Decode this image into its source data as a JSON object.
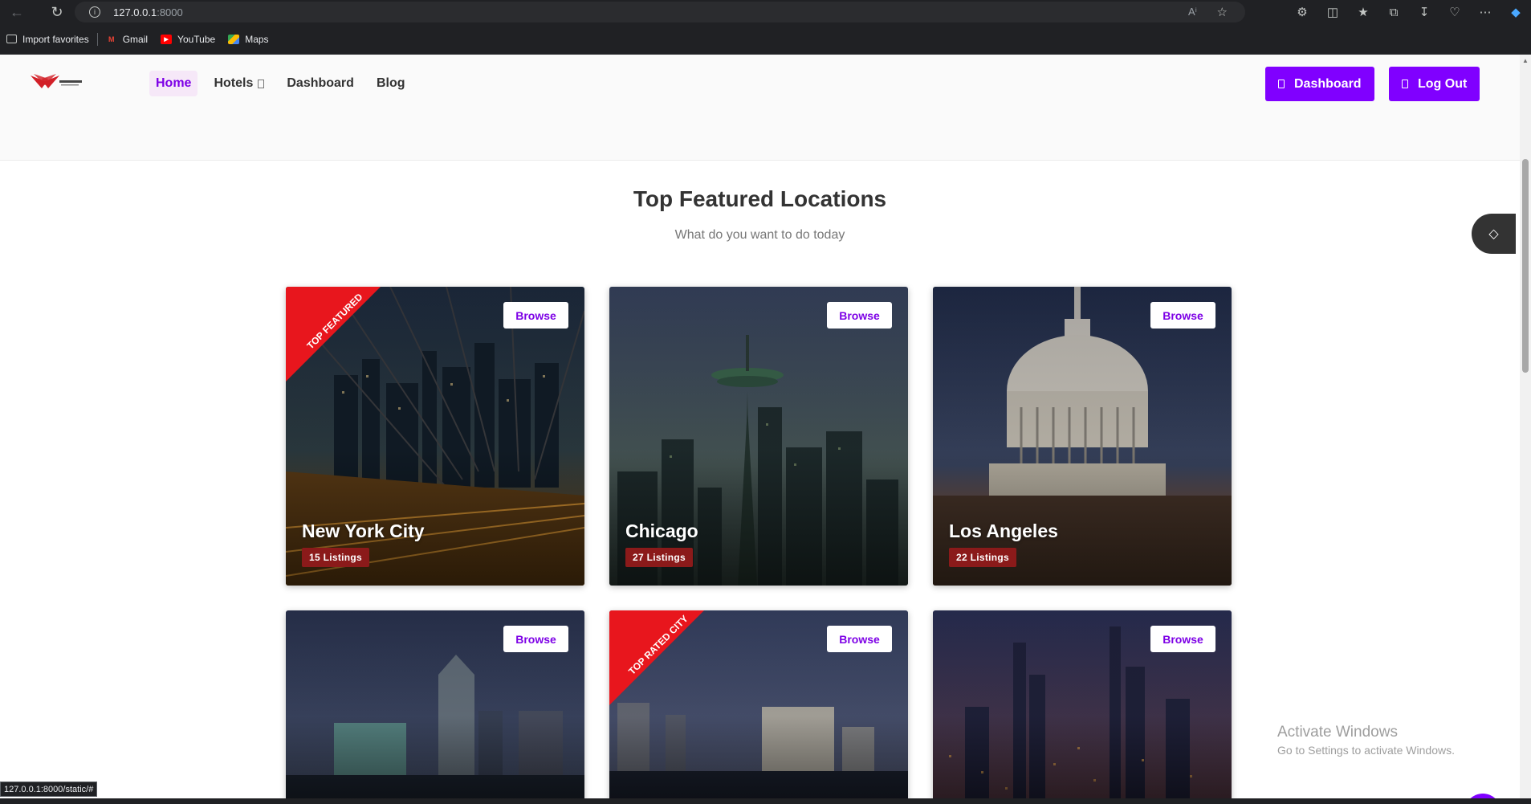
{
  "browser": {
    "url_host": "127.0.0.1",
    "url_port": ":8000",
    "bookmarks": [
      {
        "label": "Import favorites",
        "icon": "import-icon"
      },
      {
        "label": "Gmail",
        "icon": "gmail-icon"
      },
      {
        "label": "YouTube",
        "icon": "youtube-icon"
      },
      {
        "label": "Maps",
        "icon": "maps-icon"
      }
    ],
    "status_url": "127.0.0.1:8000/static/#"
  },
  "header": {
    "nav": [
      {
        "label": "Home",
        "active": true
      },
      {
        "label": "Hotels",
        "has_dropdown": true
      },
      {
        "label": "Dashboard"
      },
      {
        "label": "Blog"
      }
    ],
    "dashboard_button": "Dashboard",
    "logout_button": "Log Out"
  },
  "section": {
    "title": "Top Featured Locations",
    "subtitle": "What do you want to do today"
  },
  "cards": [
    {
      "name": "New York City",
      "listings": "15 Listings",
      "browse": "Browse",
      "ribbon": "TOP FEATURED",
      "scene": "bridge-night"
    },
    {
      "name": "Chicago",
      "listings": "27 Listings",
      "browse": "Browse",
      "ribbon": "",
      "scene": "space-needle"
    },
    {
      "name": "Los Angeles",
      "listings": "22 Listings",
      "browse": "Browse",
      "ribbon": "",
      "scene": "capitol-dome"
    },
    {
      "name": "",
      "listings": "",
      "browse": "Browse",
      "ribbon": "",
      "scene": "skyline-dusk"
    },
    {
      "name": "",
      "listings": "",
      "browse": "Browse",
      "ribbon": "TOP RATED CITY",
      "scene": "waterfront"
    },
    {
      "name": "",
      "listings": "",
      "browse": "Browse",
      "ribbon": "",
      "scene": "city-lights"
    }
  ],
  "windows": {
    "line1": "Activate Windows",
    "line2": "Go to Settings to activate Windows."
  },
  "colors": {
    "accent": "#8000ff",
    "ribbon": "#e8161d",
    "badge": "#8b1a1a"
  }
}
